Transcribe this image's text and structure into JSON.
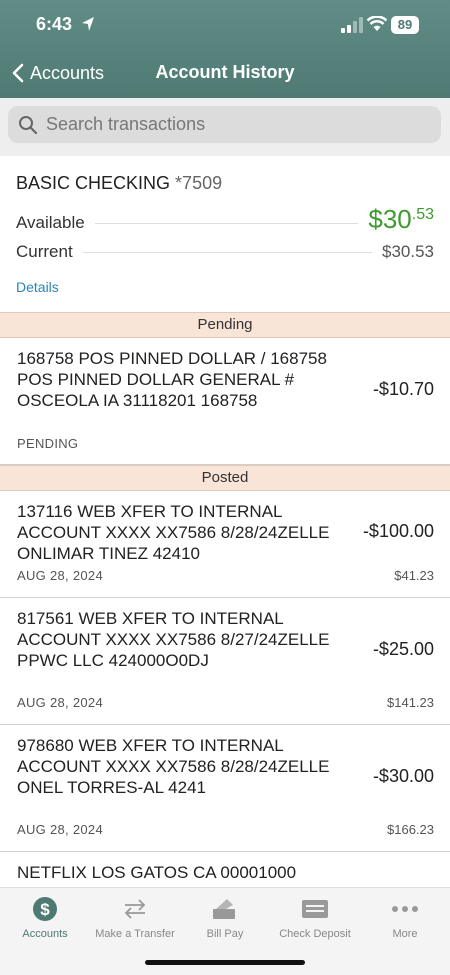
{
  "status": {
    "time": "6:43",
    "battery": "89"
  },
  "nav": {
    "back_label": "Accounts",
    "title": "Account History"
  },
  "search": {
    "placeholder": "Search transactions"
  },
  "account": {
    "name": "BASIC CHECKING",
    "number": "*7509",
    "available_label": "Available",
    "available_main": "$30",
    "available_cents": ".53",
    "current_label": "Current",
    "current_value": "$30.53",
    "details_label": "Details"
  },
  "sections": {
    "pending": "Pending",
    "posted": "Posted"
  },
  "pending": [
    {
      "description": "168758 POS PINNED DOLLAR / 168758 POS PINNED DOLLAR GENERAL # OSCEOLA IA 31118201 168758",
      "amount": "-$10.70",
      "status": "PENDING"
    }
  ],
  "posted": [
    {
      "description": "137116 WEB XFER TO INTERNAL ACCOUNT XXXX XX7586 8/28/24ZELLE ONLIMAR TINEZ 42410",
      "amount": "-$100.00",
      "date": "AUG 28, 2024",
      "balance": "$41.23"
    },
    {
      "description": "817561 WEB XFER TO INTERNAL ACCOUNT XXXX XX7586 8/27/24ZELLE PPWC LLC 424000O0DJ",
      "amount": "-$25.00",
      "date": "AUG 28, 2024",
      "balance": "$141.23"
    },
    {
      "description": "978680 WEB XFER TO INTERNAL ACCOUNT XXXX XX7586 8/28/24ZELLE ONEL TORRES-AL 4241",
      "amount": "-$30.00",
      "date": "AUG 28, 2024",
      "balance": "$166.23"
    },
    {
      "description": "NETFLIX LOS GATOS CA 00001000",
      "amount": "",
      "date": "",
      "balance": ""
    }
  ],
  "tabs": [
    {
      "label": "Accounts",
      "icon": "dollar-circle-icon"
    },
    {
      "label": "Make a Transfer",
      "icon": "transfer-arrows-icon"
    },
    {
      "label": "Bill Pay",
      "icon": "bill-pay-icon"
    },
    {
      "label": "Check Deposit",
      "icon": "check-deposit-icon"
    },
    {
      "label": "More",
      "icon": "more-dots-icon"
    }
  ],
  "colors": {
    "header": "#4e7a73",
    "available": "#3f9b2f",
    "link": "#2a86b8",
    "section_bg": "#f9e4d8"
  }
}
